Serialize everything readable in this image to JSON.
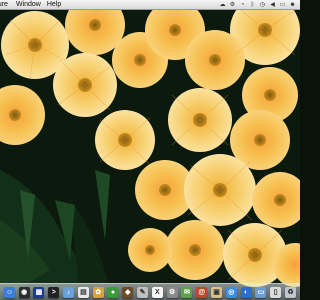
{
  "menubar": {
    "items": [
      "pture",
      "Window",
      "Help"
    ],
    "tray_icons": [
      "cloud-icon",
      "gear-icon",
      "wifi-icon",
      "bluetooth-icon",
      "clock-icon",
      "volume-icon",
      "battery-icon",
      "user-icon"
    ]
  },
  "dock": {
    "items": [
      {
        "name": "finder-icon",
        "color": "#3b7fd9",
        "glyph": "☺"
      },
      {
        "name": "dashboard-icon",
        "color": "#2b2b2b",
        "glyph": "◉"
      },
      {
        "name": "expose-icon",
        "color": "#1d3d8f",
        "glyph": "▦"
      },
      {
        "name": "terminal-icon",
        "color": "#222222",
        "glyph": ">"
      },
      {
        "name": "itunes-icon",
        "color": "#6a9fd8",
        "glyph": "♪"
      },
      {
        "name": "ical-icon",
        "color": "#e9e9e9",
        "glyph": "▤"
      },
      {
        "name": "iphoto-icon",
        "color": "#d8a437",
        "glyph": "✿"
      },
      {
        "name": "ichat-icon",
        "color": "#3a9b3a",
        "glyph": "●"
      },
      {
        "name": "app-icon",
        "color": "#6b4c2b",
        "glyph": "◆"
      },
      {
        "name": "script-editor-icon",
        "color": "#c0c0c0",
        "glyph": "✎"
      },
      {
        "name": "x11-icon",
        "color": "#f5f5f5",
        "glyph": "X"
      },
      {
        "name": "system-preferences-icon",
        "color": "#8a8a8a",
        "glyph": "⚙"
      },
      {
        "name": "mail-icon",
        "color": "#5fa04a",
        "glyph": "✉"
      },
      {
        "name": "address-book-icon",
        "color": "#b84b2b",
        "glyph": "@"
      },
      {
        "name": "preview-icon",
        "color": "#d8c090",
        "glyph": "▣"
      },
      {
        "name": "safari-icon",
        "color": "#3b8ed9",
        "glyph": "◎"
      },
      {
        "name": "app-store-icon",
        "color": "#2a6fd0",
        "glyph": "◐"
      },
      {
        "name": "folder-icon",
        "color": "#6d9bd1",
        "glyph": "▭"
      },
      {
        "name": "document-icon",
        "color": "#dcdcdc",
        "glyph": "▯"
      },
      {
        "name": "trash-icon",
        "color": "#bfc6cf",
        "glyph": "♻"
      }
    ]
  }
}
